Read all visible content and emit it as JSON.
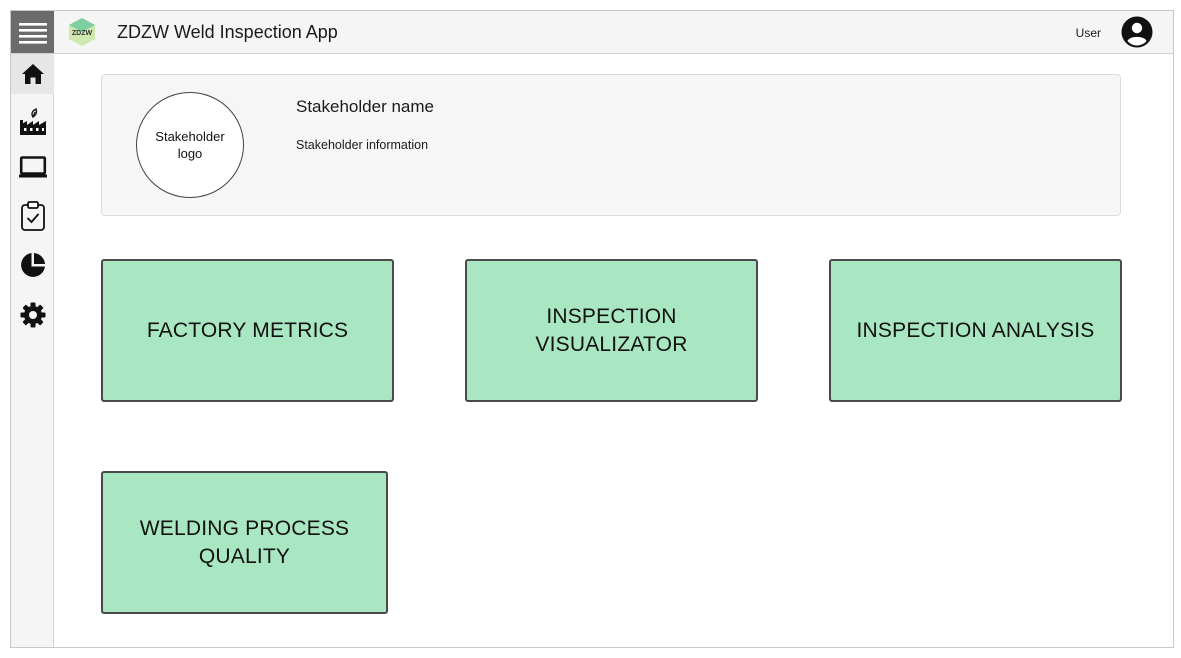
{
  "header": {
    "app_title": "ZDZW Weld Inspection App",
    "logo_text": "ZDZW",
    "user_label": "User"
  },
  "sidebar": {
    "items": [
      {
        "icon": "home-icon",
        "active": true
      },
      {
        "icon": "factory-icon",
        "active": false
      },
      {
        "icon": "laptop-icon",
        "active": false
      },
      {
        "icon": "clipboard-check-icon",
        "active": false
      },
      {
        "icon": "pie-chart-icon",
        "active": false
      },
      {
        "icon": "gear-icon",
        "active": false
      }
    ]
  },
  "stakeholder": {
    "logo_text": "Stakeholder logo",
    "name": "Stakeholder name",
    "info": "Stakeholder information"
  },
  "tiles": [
    {
      "label": "FACTORY METRICS"
    },
    {
      "label": "INSPECTION\nVISUALIZATOR"
    },
    {
      "label": "INSPECTION ANALYSIS"
    },
    {
      "label": "WELDING PROCESS\nQUALITY"
    }
  ],
  "colors": {
    "tile_fill": "#a9e6c2",
    "tile_border": "#4a4a4a",
    "menu_button": "#6b6b6b"
  }
}
